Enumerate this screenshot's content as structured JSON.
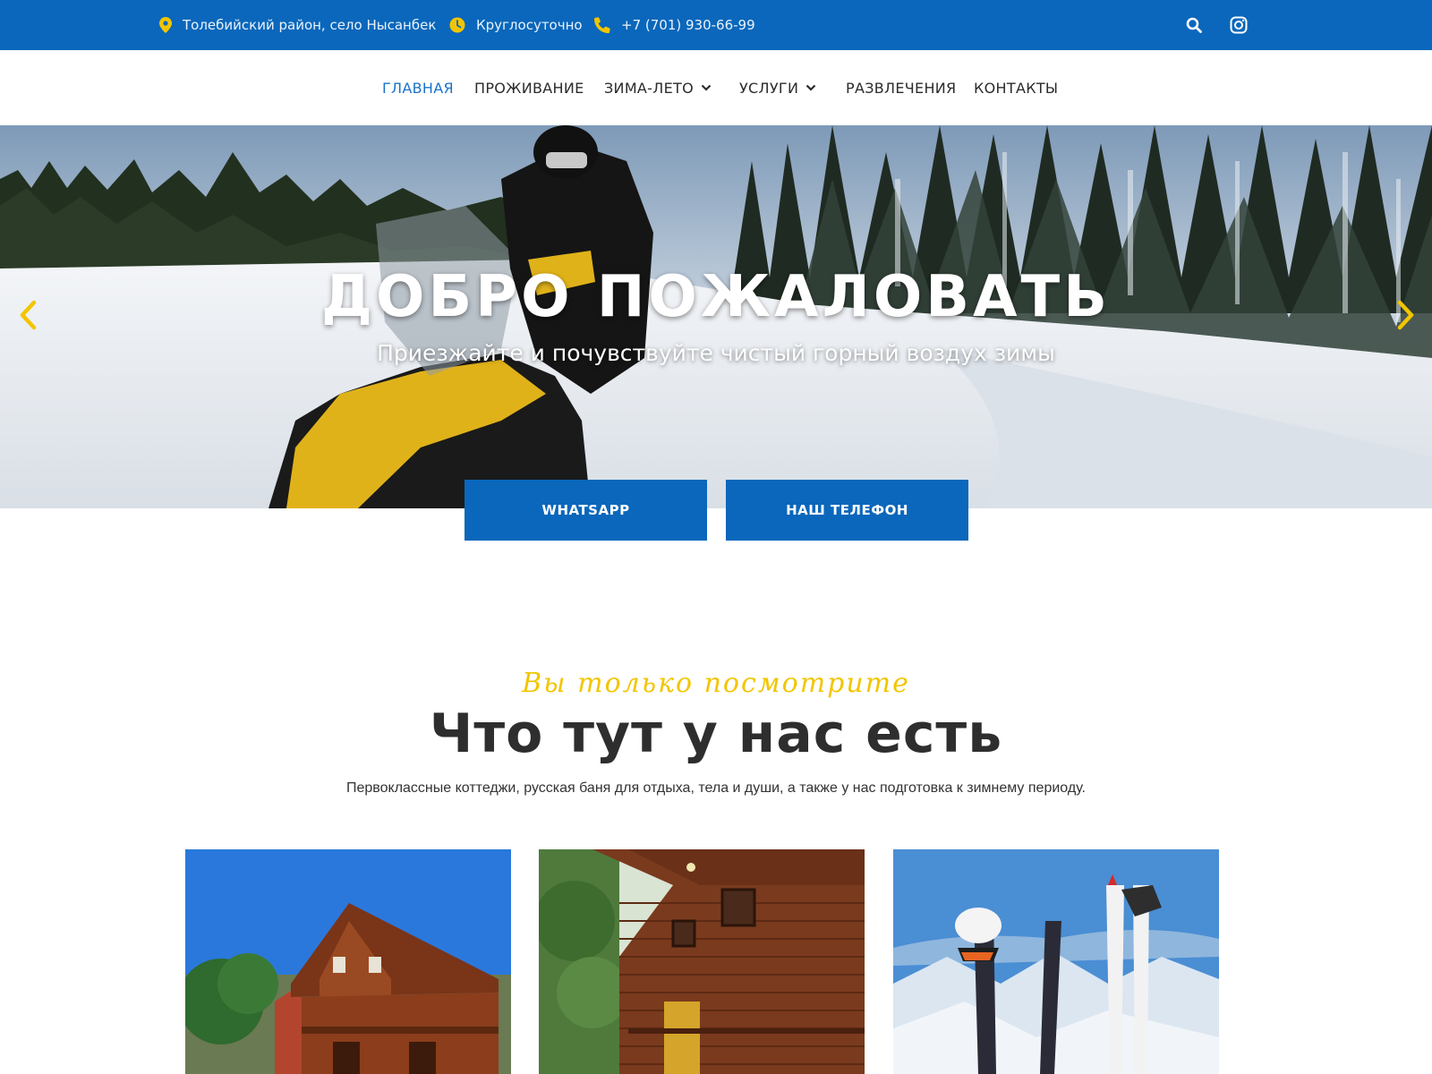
{
  "topbar": {
    "address": "Толебийский район, село Нысанбек",
    "hours": "Круглосуточно",
    "phone": "+7 (701) 930-66-99",
    "icons": [
      "map-pin-icon",
      "clock-icon",
      "phone-icon",
      "search-icon",
      "instagram-icon"
    ],
    "bg_color": "#0a67bb",
    "icon_color": "#f2c500"
  },
  "nav": {
    "items": [
      {
        "label": "ГЛАВНАЯ",
        "active": true
      },
      {
        "label": "ПРОЖИВАНИЕ"
      },
      {
        "label": "ЗИМА-ЛЕТО",
        "dropdown": true
      },
      {
        "label": "УСЛУГИ",
        "dropdown": true
      },
      {
        "label": "РАЗВЛЕЧЕНИЯ"
      },
      {
        "label": "КОНТАКТЫ"
      }
    ],
    "active_color": "#1a73c9"
  },
  "hero": {
    "title": "ДОБРО ПОЖАЛОВАТЬ",
    "subtitle": "Приезжайте и почувствуйте чистый горный воздух зимы",
    "arrow_color": "#f2c500"
  },
  "buttons": {
    "whatsapp": "WHATSAPP",
    "phone": "НАШ ТЕЛЕФОН"
  },
  "section": {
    "kicker": "Вы только посмотрите",
    "title": "Что тут у нас есть",
    "description": "Первоклассные коттеджи, русская баня для отдыха, тела и души, а также у нас подготовка к зимнему периоду."
  },
  "cards": [
    {
      "name": "cottage-photo"
    },
    {
      "name": "wooden-house-photo"
    },
    {
      "name": "ski-equipment-photo"
    }
  ]
}
